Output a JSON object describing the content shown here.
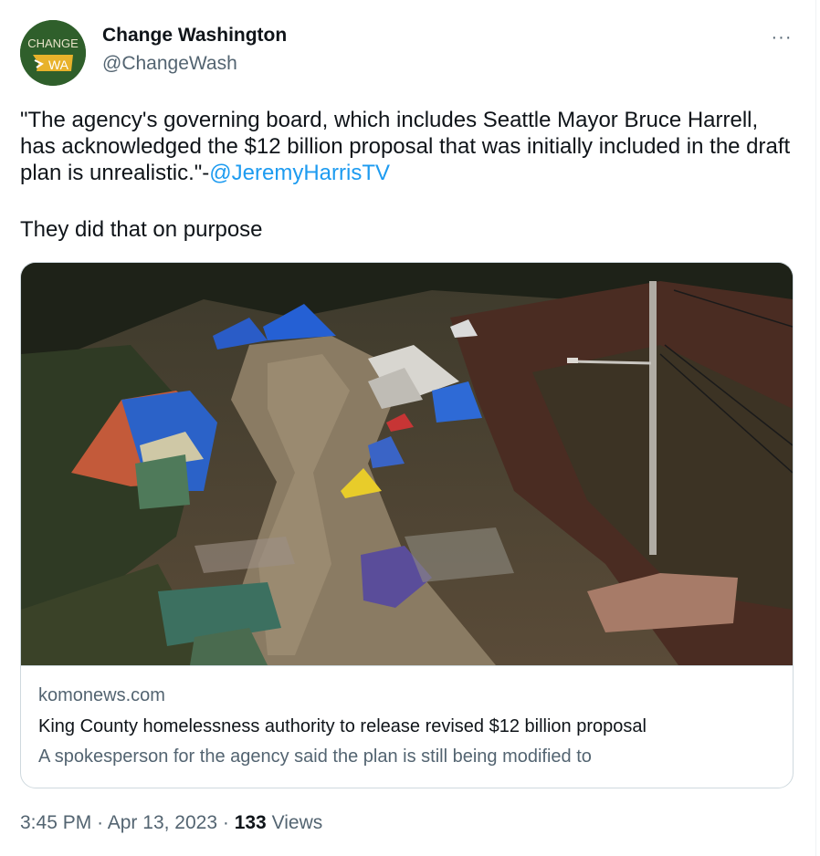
{
  "author": {
    "name": "Change Washington",
    "handle": "@ChangeWash",
    "avatar_text_top": "CHANGE",
    "avatar_text_bottom": "WA"
  },
  "more_icon": "more-horizontal-icon",
  "more_label": "···",
  "tweet": {
    "quote": "\"The agency's governing board, which includes Seattle Mayor Bruce Harrell, has acknowledged the $12 billion proposal that was initially included in the draft plan is unrealistic.\"-",
    "mention": "@JeremyHarrisTV",
    "followup": "They did that on purpose"
  },
  "card": {
    "domain": "komonews.com",
    "title": "King County homelessness authority to release revised $12 billion proposal",
    "description": "A spokesperson for the agency said the plan is still being modified to"
  },
  "meta": {
    "time": "3:45 PM",
    "separator": "·",
    "date": "Apr 13, 2023",
    "views_count": "133",
    "views_label": "Views"
  },
  "colors": {
    "link": "#1d9bf0",
    "secondary": "#536471",
    "avatar_bg": "#2f5f2b",
    "avatar_badge": "#e8b22b"
  }
}
